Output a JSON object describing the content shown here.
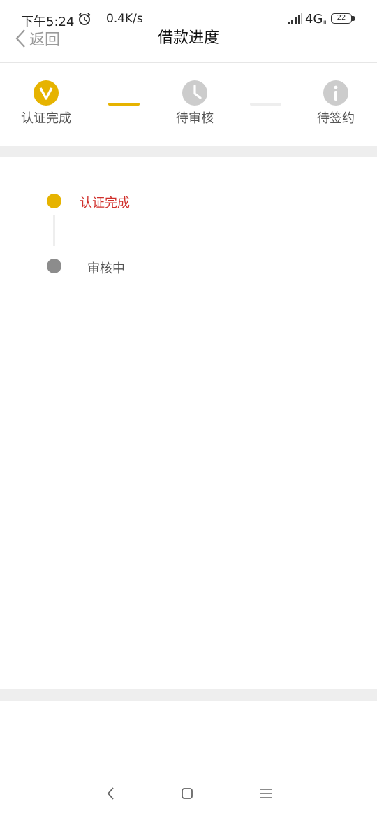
{
  "status_bar": {
    "time": "下午5:24",
    "speed": "0.4K/s",
    "network": "4G",
    "network_sub": "ıı",
    "battery": "22",
    "icons": [
      "alarm-icon",
      "signal-icon",
      "battery-icon"
    ]
  },
  "nav": {
    "back_label": "返回",
    "title": "借款进度"
  },
  "stepper": {
    "steps": [
      {
        "label": "认证完成",
        "icon": "check-v-icon",
        "color": "#e6b300"
      },
      {
        "label": "待审核",
        "icon": "clock-icon",
        "color": "#cccccc"
      },
      {
        "label": "待签约",
        "icon": "info-icon",
        "color": "#cccccc"
      }
    ],
    "active_color": "#e6b300",
    "inactive_color": "#eeeeee"
  },
  "timeline": {
    "items": [
      {
        "label": "认证完成",
        "color": "#d0302c",
        "dot_color": "#e6b300"
      },
      {
        "label": "审核中",
        "color": "#555555",
        "dot_color": "#8c8c8c"
      }
    ]
  },
  "system_nav": {
    "icons": [
      "back-triangle-icon",
      "home-square-icon",
      "menu-lines-icon"
    ]
  }
}
